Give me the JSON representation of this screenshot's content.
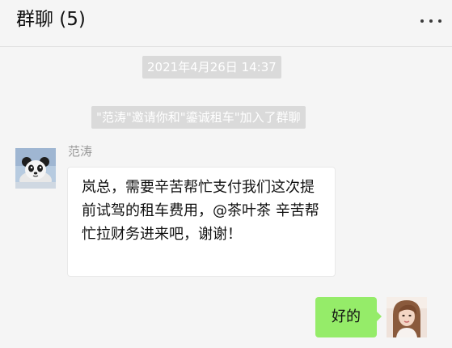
{
  "header": {
    "title": "群聊 (5)",
    "more_icon": "more-dots-icon"
  },
  "chat": {
    "timestamp": "2021年4月26日 14:37",
    "system_message": "\"范涛\"邀请你和\"鎏诚租车\"加入了群聊",
    "incoming": {
      "sender": "范涛",
      "avatar": "panda-avatar",
      "text": "岚总，需要辛苦帮忙支付我们这次提前试驾的租车费用，@茶叶茶 辛苦帮忙拉财务进来吧，谢谢！"
    },
    "outgoing": {
      "avatar": "woman-avatar",
      "text": "好的"
    }
  },
  "colors": {
    "background": "#f5f5f5",
    "outgoing_bubble": "#95ec69",
    "incoming_bubble": "#ffffff",
    "system_chip": "#dadada"
  }
}
